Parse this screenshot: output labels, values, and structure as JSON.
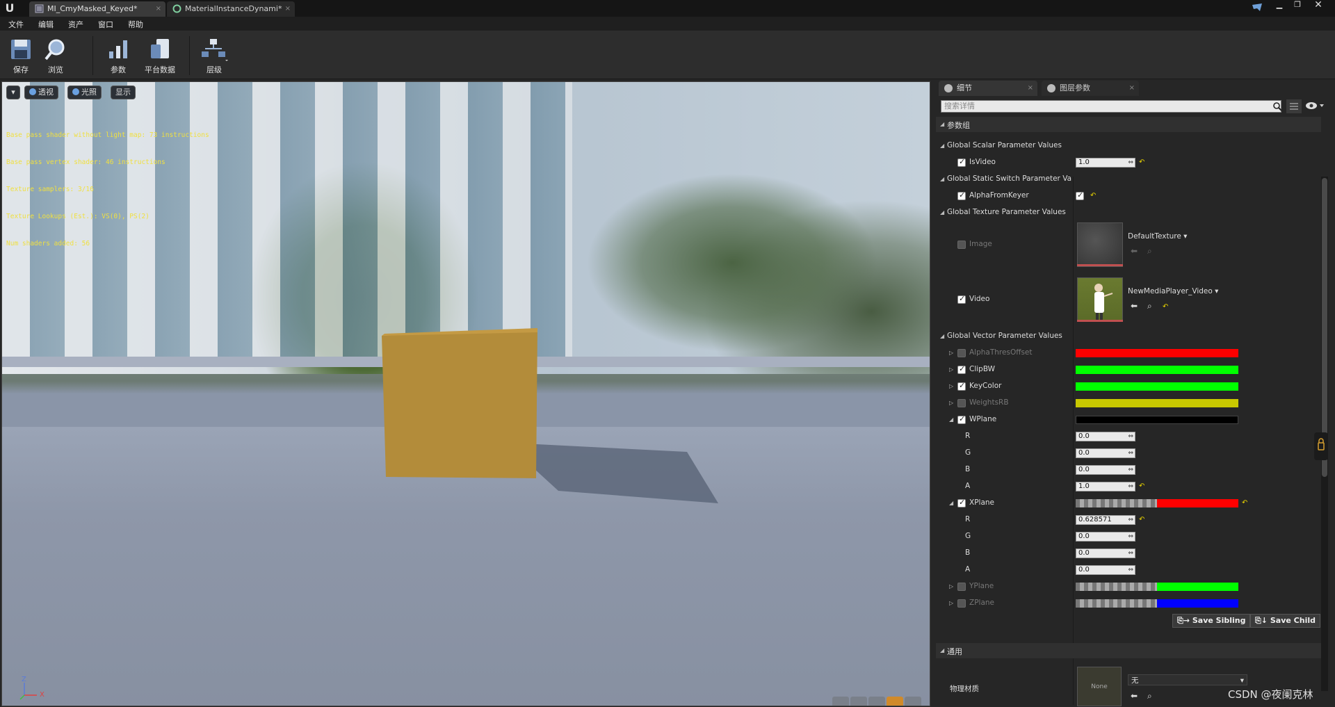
{
  "titlebar": {
    "tabs": [
      {
        "label": "MI_CmyMasked_Keyed*",
        "active": true
      },
      {
        "label": "MaterialInstanceDynami*",
        "active": false
      }
    ]
  },
  "menu": {
    "items": [
      "文件",
      "编辑",
      "资产",
      "窗口",
      "帮助"
    ]
  },
  "toolbar": {
    "buttons": [
      {
        "label": "保存",
        "icon": "save-icon"
      },
      {
        "label": "浏览",
        "icon": "browse-icon"
      },
      {
        "label": "参数",
        "icon": "params-icon"
      },
      {
        "label": "平台数据",
        "icon": "platform-data-icon"
      },
      {
        "label": "层级",
        "icon": "hierarchy-icon"
      }
    ]
  },
  "viewport": {
    "buttons": {
      "perspective": "透视",
      "lit": "光照",
      "show": "显示"
    },
    "stats": [
      "Base pass shader without light map: 73 instructions",
      "Base pass vertex shader: 46 instructions",
      "Texture samplers: 3/16",
      "Texture Lookups (Est.): VS(0), PS(2)",
      "Num shaders added: 56"
    ],
    "axis": {
      "z": "Z",
      "x": "X"
    }
  },
  "details": {
    "tabs": {
      "details": "细节",
      "layer_params": "图层参数"
    },
    "search_placeholder": "搜索详情",
    "param_group_header": "参数组",
    "groups": {
      "scalar": "Global Scalar Parameter Values",
      "static_switch": "Global Static Switch Parameter Va",
      "texture": "Global Texture Parameter Values",
      "vector": "Global Vector Parameter Values"
    },
    "scalar": {
      "is_video_label": "IsVideo",
      "is_video_value": "1.0"
    },
    "static_switch": {
      "alpha_from_keyer_label": "AlphaFromKeyer"
    },
    "texture": {
      "image_label": "Image",
      "image_value": "DefaultTexture",
      "video_label": "Video",
      "video_value": "NewMediaPlayer_Video"
    },
    "vector_params": [
      {
        "name": "AlphaThresOffset",
        "enabled": false,
        "color": "#ff0000"
      },
      {
        "name": "ClipBW",
        "enabled": true,
        "color": "#00ff00"
      },
      {
        "name": "KeyColor",
        "enabled": true,
        "color": "#00ff00"
      },
      {
        "name": "WeightsRB",
        "enabled": false,
        "color": "#c8c800"
      },
      {
        "name": "WPlane",
        "enabled": true,
        "color": "#000000"
      },
      {
        "name": "XPlane",
        "enabled": true,
        "color": "#ff0000"
      },
      {
        "name": "YPlane",
        "enabled": false,
        "color": "#00ff00"
      },
      {
        "name": "ZPlane",
        "enabled": false,
        "color": "#0000ff"
      }
    ],
    "wplane": {
      "R": "0.0",
      "G": "0.0",
      "B": "0.0",
      "A": "1.0"
    },
    "xplane": {
      "R": "0.628571",
      "G": "0.0",
      "B": "0.0",
      "A": "0.0"
    },
    "channel_labels": {
      "r": "R",
      "g": "G",
      "b": "B",
      "a": "A"
    },
    "save_sibling": "Save Sibling",
    "save_child": "Save Child",
    "general_header": "通用",
    "phys_material_label": "物理材质",
    "phys_material_thumb": "None",
    "phys_material_value": "无"
  },
  "watermark": "CSDN @夜阑克林"
}
